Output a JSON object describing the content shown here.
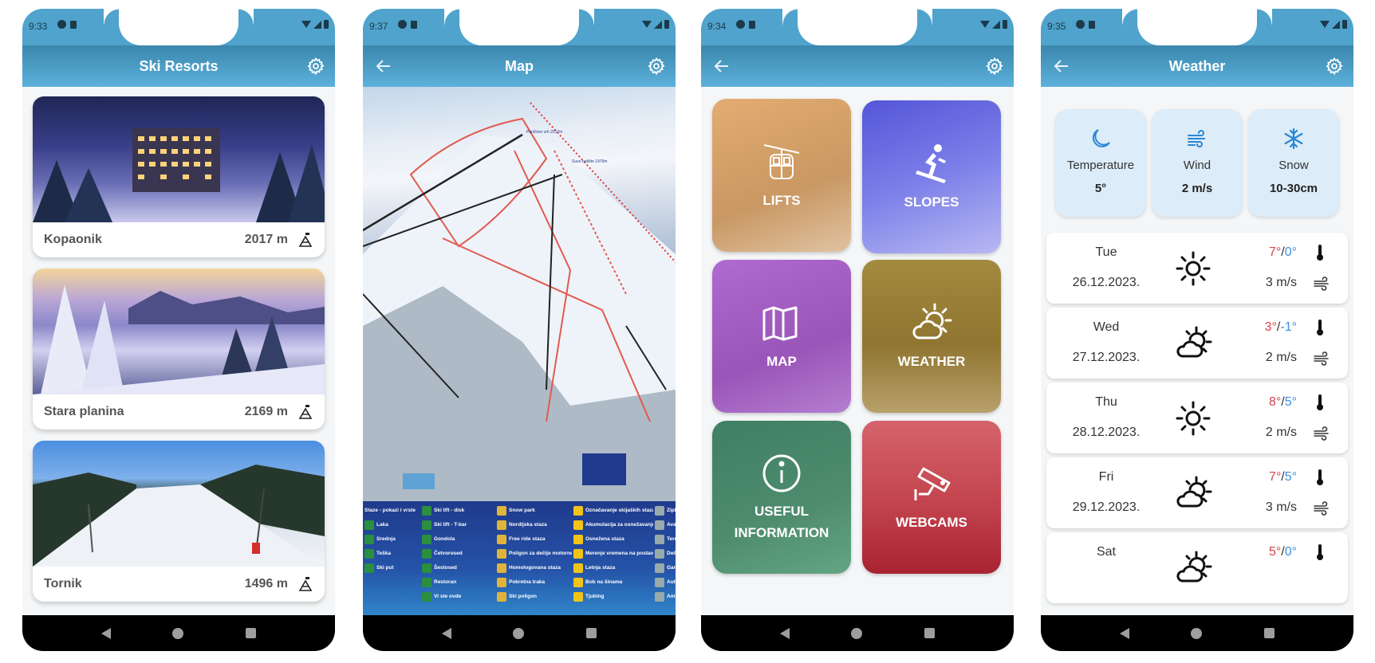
{
  "screens": [
    {
      "status_time": "9:33",
      "title": "Ski Resorts",
      "has_back": false,
      "resorts": [
        {
          "name": "Kopaonik",
          "altitude": "2017 m",
          "icon": "mountain-flag-icon"
        },
        {
          "name": "Stara planina",
          "altitude": "2169 m",
          "icon": "mountain-flag-icon"
        },
        {
          "name": "Tornik",
          "altitude": "1496 m",
          "icon": "mountain-flag-icon"
        }
      ]
    },
    {
      "status_time": "9:37",
      "title": "Map",
      "has_back": true,
      "map_labels": [
        "Pančićev vrh 2017m",
        "Suvo rudište 1976m"
      ],
      "legend": [
        [
          "Staze - pokazi i vrste",
          "Laka",
          "Srednja",
          "Teška",
          "Ski put"
        ],
        [
          "Ski lift - disk",
          "Ski lift - T-bar",
          "Gondola",
          "Četvorosed",
          "Šestosed",
          "Restoran",
          "Vi ste ovde"
        ],
        [
          "Snow park",
          "Nordijska staza",
          "Free ride staza",
          "Poligon za dečije motorne sanke",
          "Homologovana staza",
          "Pokretna traka",
          "Ski poligon"
        ],
        [
          "Označavanje skijaških staza",
          "Akumulacija za osnežavanje",
          "Osnežena staza",
          "Merenje vremena na postavljenoj stazi",
          "Letnja staza",
          "Bob na šinama",
          "Tjubing"
        ],
        [
          "Zipline",
          "Avant",
          "Teren",
          "Dečji",
          "Garaž",
          "Autob. stanica",
          "Ambul."
        ]
      ]
    },
    {
      "status_time": "9:34",
      "title": "",
      "has_back": true,
      "tiles": [
        {
          "label": "LIFTS",
          "icon": "cable-car-icon",
          "color": "#d9a66f"
        },
        {
          "label": "SLOPES",
          "icon": "skier-icon",
          "color": "#6a6ee0"
        },
        {
          "label": "MAP",
          "icon": "map-icon",
          "color": "#a65fc0"
        },
        {
          "label": "WEATHER",
          "icon": "partly-sunny-icon",
          "color": "#9d8135"
        },
        {
          "label": "USEFUL\nINFORMATION",
          "label_line1": "USEFUL",
          "label_line2": "INFORMATION",
          "icon": "info-icon",
          "color": "#4f8c6e"
        },
        {
          "label": "WEBCAMS",
          "icon": "webcam-icon",
          "color": "#c2434d"
        }
      ]
    },
    {
      "status_time": "9:35",
      "title": "Weather",
      "has_back": true,
      "current": [
        {
          "label": "Temperature",
          "value": "5°",
          "icon": "moon-icon"
        },
        {
          "label": "Wind",
          "value": "2 m/s",
          "icon": "wind-icon"
        },
        {
          "label": "Snow",
          "value": "10-30cm",
          "icon": "snowflake-icon"
        }
      ],
      "forecast": [
        {
          "day": "Tue",
          "date": "26.12.2023.",
          "condition": "sunny",
          "high": "7°",
          "low": "0°",
          "wind": "3 m/s"
        },
        {
          "day": "Wed",
          "date": "27.12.2023.",
          "condition": "partly-cloudy",
          "high": "3°",
          "low": "-1°",
          "wind": "2 m/s"
        },
        {
          "day": "Thu",
          "date": "28.12.2023.",
          "condition": "sunny",
          "high": "8°",
          "low": "5°",
          "wind": "2 m/s"
        },
        {
          "day": "Fri",
          "date": "29.12.2023.",
          "condition": "partly-cloudy",
          "high": "7°",
          "low": "5°",
          "wind": "3 m/s"
        },
        {
          "day": "Sat",
          "date": "",
          "condition": "partly-cloudy",
          "high": "5°",
          "low": "0°",
          "wind": ""
        }
      ]
    }
  ],
  "colors": {
    "status_bar": "#4fa3cc",
    "app_bar_top": "#3b87ad",
    "app_bar_bottom": "#5cb1dc",
    "temp_high": "#d0454f",
    "temp_low": "#3b8fde",
    "stat_card_bg": "#dcecf8",
    "icon_blue": "#2a86d4"
  },
  "temp_separator": "/"
}
